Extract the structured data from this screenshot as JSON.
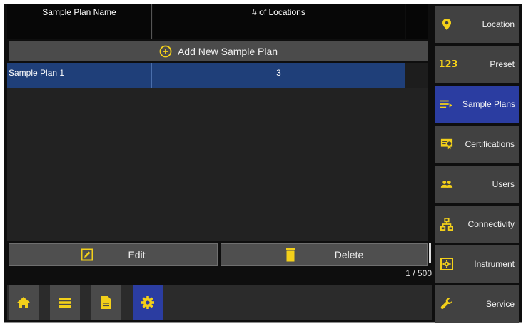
{
  "table": {
    "headers": [
      "Sample Plan Name",
      "# of Locations"
    ],
    "add_label": "Add New Sample Plan",
    "rows": [
      {
        "name": "Sample Plan 1",
        "locations": "3"
      }
    ]
  },
  "actions": {
    "edit_label": "Edit",
    "delete_label": "Delete",
    "pager": "1 / 500"
  },
  "bottom_nav": {
    "items": [
      "home-icon",
      "list-icon",
      "document-icon",
      "settings-icon"
    ],
    "active": "settings-icon"
  },
  "sidebar": {
    "items": [
      {
        "label": "Location",
        "icon": "location-pin-icon"
      },
      {
        "label": "Preset",
        "icon": "numbers-icon",
        "icon_text": "123"
      },
      {
        "label": "Sample Plans",
        "icon": "sample-plans-icon"
      },
      {
        "label": "Certifications",
        "icon": "certificate-icon"
      },
      {
        "label": "Users",
        "icon": "users-icon"
      },
      {
        "label": "Connectivity",
        "icon": "network-icon"
      },
      {
        "label": "Instrument",
        "icon": "instrument-icon"
      },
      {
        "label": "Service",
        "icon": "wrench-icon"
      }
    ],
    "active": "Sample Plans"
  },
  "colors": {
    "accent": "#2b3da1",
    "selected_row": "#1f3f79",
    "icon_yellow": "#f3d01a"
  }
}
